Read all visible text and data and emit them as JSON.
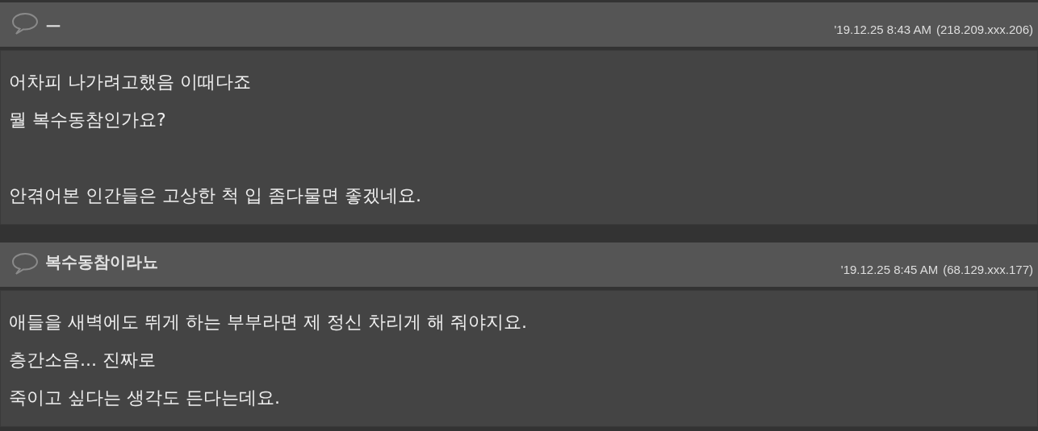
{
  "comments": [
    {
      "author": "ㅡ",
      "date": "'19.12.25 8:43 AM",
      "ip": "(218.209.xxx.206)",
      "paragraphs": [
        [
          "어차피 나가려고했음 이때다죠",
          "뭘 복수동참인가요?"
        ],
        [
          "안겪어본 인간들은 고상한 척 입 좀다물면 좋겠네요."
        ]
      ]
    },
    {
      "author": "복수동참이라뇨",
      "date": "'19.12.25 8:45 AM",
      "ip": "(68.129.xxx.177)",
      "paragraphs": [
        [
          "애들을 새벽에도 뛰게 하는 부부라면 제 정신 차리게 해 줘야지요.",
          "층간소음... 진짜로",
          "죽이고 싶다는 생각도 든다는데요."
        ]
      ]
    }
  ]
}
